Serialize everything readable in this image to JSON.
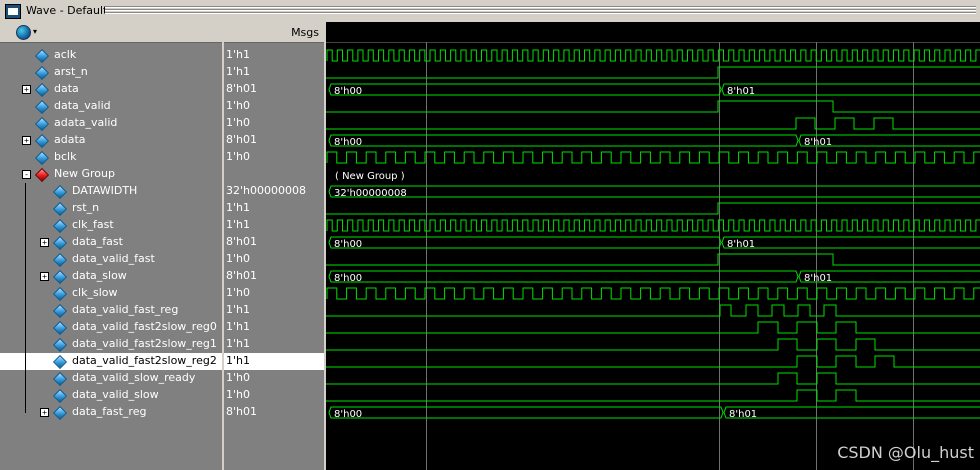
{
  "window": {
    "title": "Wave - Default"
  },
  "header": {
    "msgs_label": "Msgs"
  },
  "signals": [
    {
      "name": "aclk",
      "value": "1'h1",
      "indent": 0,
      "expand": false,
      "icon": "blue"
    },
    {
      "name": "arst_n",
      "value": "1'h1",
      "indent": 0,
      "expand": false,
      "icon": "blue"
    },
    {
      "name": "data",
      "value": "8'h01",
      "indent": 0,
      "expand": true,
      "icon": "blue"
    },
    {
      "name": "data_valid",
      "value": "1'h0",
      "indent": 0,
      "expand": false,
      "icon": "blue"
    },
    {
      "name": "adata_valid",
      "value": "1'h0",
      "indent": 0,
      "expand": false,
      "icon": "blue"
    },
    {
      "name": "adata",
      "value": "8'h01",
      "indent": 0,
      "expand": true,
      "icon": "blue"
    },
    {
      "name": "bclk",
      "value": "1'h0",
      "indent": 0,
      "expand": false,
      "icon": "blue"
    },
    {
      "name": "New Group",
      "value": "",
      "indent": 0,
      "expand": "minus",
      "icon": "red"
    },
    {
      "name": "DATAWIDTH",
      "value": "32'h00000008",
      "indent": 1,
      "expand": false,
      "icon": "blue"
    },
    {
      "name": "rst_n",
      "value": "1'h1",
      "indent": 1,
      "expand": false,
      "icon": "blue"
    },
    {
      "name": "clk_fast",
      "value": "1'h1",
      "indent": 1,
      "expand": false,
      "icon": "blue"
    },
    {
      "name": "data_fast",
      "value": "8'h01",
      "indent": 1,
      "expand": true,
      "icon": "blue"
    },
    {
      "name": "data_valid_fast",
      "value": "1'h0",
      "indent": 1,
      "expand": false,
      "icon": "blue"
    },
    {
      "name": "data_slow",
      "value": "8'h01",
      "indent": 1,
      "expand": true,
      "icon": "blue"
    },
    {
      "name": "clk_slow",
      "value": "1'h0",
      "indent": 1,
      "expand": false,
      "icon": "blue"
    },
    {
      "name": "data_valid_fast_reg",
      "value": "1'h1",
      "indent": 1,
      "expand": false,
      "icon": "blue"
    },
    {
      "name": "data_valid_fast2slow_reg0",
      "value": "1'h1",
      "indent": 1,
      "expand": false,
      "icon": "blue"
    },
    {
      "name": "data_valid_fast2slow_reg1",
      "value": "1'h1",
      "indent": 1,
      "expand": false,
      "icon": "blue"
    },
    {
      "name": "data_valid_fast2slow_reg2",
      "value": "1'h1",
      "indent": 1,
      "expand": false,
      "icon": "blue",
      "selected": true
    },
    {
      "name": "data_valid_slow_ready",
      "value": "1'h0",
      "indent": 1,
      "expand": false,
      "icon": "blue"
    },
    {
      "name": "data_valid_slow",
      "value": "1'h0",
      "indent": 1,
      "expand": false,
      "icon": "blue"
    },
    {
      "name": "data_fast_reg",
      "value": "8'h01",
      "indent": 1,
      "expand": true,
      "icon": "blue"
    }
  ],
  "waves": [
    {
      "type": "clock",
      "half": 5.15,
      "start": 1
    },
    {
      "type": "bit",
      "init": 0,
      "edges": [
        392
      ]
    },
    {
      "type": "bus",
      "segments": [
        {
          "start": 0,
          "label": "8'h00"
        },
        {
          "start": 393,
          "label": "8'h01"
        }
      ]
    },
    {
      "type": "bit",
      "init": 0,
      "edges": [
        392,
        507
      ]
    },
    {
      "type": "bit",
      "init": 0,
      "edges": [
        470,
        489,
        509,
        528,
        548,
        567
      ]
    },
    {
      "type": "bus",
      "segments": [
        {
          "start": 0,
          "label": "8'h00"
        },
        {
          "start": 470,
          "label": "8'h01"
        }
      ]
    },
    {
      "type": "clock",
      "half": 9.8,
      "start": 1
    },
    {
      "type": "group",
      "label": "( New Group )"
    },
    {
      "type": "bus",
      "segments": [
        {
          "start": 0,
          "label": "32'h00000008"
        }
      ]
    },
    {
      "type": "bit",
      "init": 0,
      "edges": [
        392
      ]
    },
    {
      "type": "clock",
      "half": 5.15,
      "start": 1
    },
    {
      "type": "bus",
      "segments": [
        {
          "start": 0,
          "label": "8'h00"
        },
        {
          "start": 393,
          "label": "8'h01"
        }
      ]
    },
    {
      "type": "bit",
      "init": 0,
      "edges": [
        392,
        507
      ]
    },
    {
      "type": "bus",
      "segments": [
        {
          "start": 0,
          "label": "8'h00"
        },
        {
          "start": 470,
          "label": "8'h01"
        }
      ]
    },
    {
      "type": "clock",
      "half": 9.8,
      "start": 1
    },
    {
      "type": "bit",
      "init": 0,
      "edges": [
        394,
        405,
        420,
        432,
        446,
        458,
        472,
        484,
        498,
        510
      ]
    },
    {
      "type": "bit",
      "init": 0,
      "edges": [
        432,
        452,
        471,
        491,
        510,
        530
      ]
    },
    {
      "type": "bit",
      "init": 0,
      "edges": [
        452,
        471,
        491,
        510,
        530,
        549
      ]
    },
    {
      "type": "bit",
      "init": 0,
      "edges": [
        471,
        491,
        510,
        530,
        549,
        568
      ]
    },
    {
      "type": "bit",
      "init": 0,
      "edges": [
        452,
        471,
        491,
        510
      ]
    },
    {
      "type": "bit",
      "init": 0,
      "edges": [
        471,
        491,
        510,
        530
      ]
    },
    {
      "type": "bus",
      "segments": [
        {
          "start": 0,
          "label": "8'h00"
        },
        {
          "start": 395,
          "label": "8'h01"
        }
      ]
    }
  ],
  "cursors": [
    100,
    393,
    490,
    587
  ],
  "colors": {
    "wave": "#00e000",
    "text": "#ffffff",
    "cursor": "#707070"
  },
  "watermark": "CSDN @Olu_hust"
}
